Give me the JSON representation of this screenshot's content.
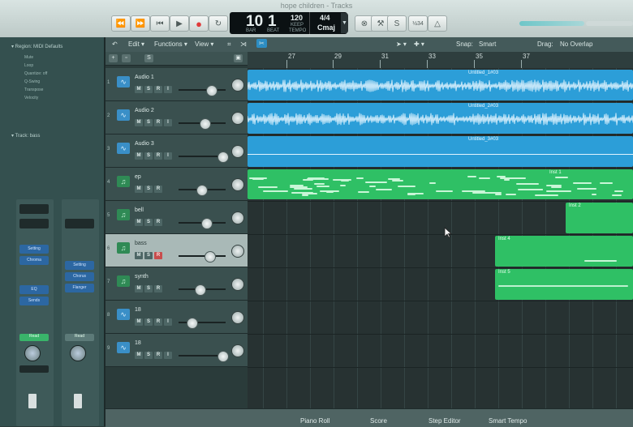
{
  "window": {
    "title": "hope children - Tracks"
  },
  "transport": {
    "rewind": "⏪",
    "forward": "⏩",
    "to_start": "⏮",
    "play": "▶",
    "record": "●",
    "cycle": "↻",
    "lcd": {
      "bar": "10",
      "beat": "1",
      "bar_label": "BAR",
      "beat_label": "BEAT",
      "tempo": "120",
      "tempo_top": "KEEP",
      "tempo_label": "TEMPO",
      "signature": "4/4",
      "key": "Cmaj"
    },
    "tuner_icon": "⚒",
    "count_in": "½34"
  },
  "inspector": {
    "header": "▾ Region: MIDI Defaults",
    "rows": [
      "Mute",
      "Loop",
      "Quantize: off",
      "Q-Swing",
      "Transpose",
      "Velocity"
    ],
    "track_label": "▾ Track: bass",
    "strip_buttons_left": [
      "Setting",
      "Chroma",
      "EQ"
    ],
    "strip_buttons_right": [
      "Setting",
      "Chorus",
      "Flanger"
    ],
    "strip_send_left": "Sends",
    "strip_labels": [
      "Read",
      "Read"
    ]
  },
  "toolbar": {
    "edit": "Edit ▾",
    "functions": "Functions ▾",
    "view": "View ▾",
    "snap_label": "Snap:",
    "snap_value": "Smart",
    "drag_label": "Drag:",
    "drag_value": "No Overlap"
  },
  "ruler": {
    "bars": [
      "27",
      "29",
      "31",
      "33",
      "35",
      "37"
    ]
  },
  "tracks": [
    {
      "num": "1",
      "name": "Audio 1",
      "type": "audio",
      "m": "M",
      "s": "S",
      "r": "R",
      "i": "I"
    },
    {
      "num": "2",
      "name": "Audio 2",
      "type": "audio",
      "m": "M",
      "s": "S",
      "r": "R",
      "i": "I"
    },
    {
      "num": "3",
      "name": "Audio 3",
      "type": "audio",
      "m": "M",
      "s": "S",
      "r": "R",
      "i": "I"
    },
    {
      "num": "4",
      "name": "ep",
      "type": "midi",
      "m": "M",
      "s": "S",
      "r": "R"
    },
    {
      "num": "5",
      "name": "bell",
      "type": "midi",
      "m": "M",
      "s": "S",
      "r": "R"
    },
    {
      "num": "6",
      "name": "bass",
      "type": "midi",
      "m": "M",
      "s": "S",
      "r": "R"
    },
    {
      "num": "7",
      "name": "synth",
      "type": "midi",
      "m": "M",
      "s": "S",
      "r": "R"
    },
    {
      "num": "8",
      "name": "18",
      "type": "audio",
      "m": "M",
      "s": "S",
      "r": "R",
      "i": "I"
    },
    {
      "num": "9",
      "name": "18",
      "type": "audio",
      "m": "M",
      "s": "S",
      "r": "R",
      "i": "I"
    }
  ],
  "regions": [
    {
      "label": "Untitled_1#03"
    },
    {
      "label": "Untitled_2#03"
    },
    {
      "label": "Untitled_3#03"
    },
    {
      "label": "Inst 1"
    },
    {
      "label": "Inst 2"
    },
    {
      "label": "Inst 4"
    },
    {
      "label": "Inst 5"
    }
  ],
  "bottom_tabs": [
    "Piano Roll",
    "Score",
    "Step Editor",
    "Smart Tempo"
  ],
  "colors": {
    "audio_region": "#2c9ed8",
    "midi_region": "#2fc065",
    "record": "#e03a3a"
  }
}
